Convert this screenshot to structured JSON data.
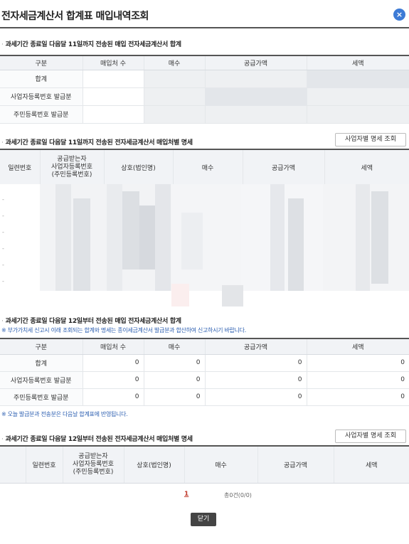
{
  "window": {
    "title": "전자세금계산서 합계표 매입내역조회",
    "close_icon": "close-icon"
  },
  "section1": {
    "title": "과세기간 종료일 다음달 11일까지 전송된 매입 전자세금계산서 합계",
    "headers": [
      "구분",
      "매입처 수",
      "매수",
      "공급가액",
      "세액"
    ],
    "rows": [
      {
        "label": "합계"
      },
      {
        "label": "사업자등록번호 발급분"
      },
      {
        "label": "주민등록번호 발급분"
      }
    ]
  },
  "section2": {
    "title": "과세기간 종료일 다음달 11일까지 전송된 전자세금계산서 매입처별 명세",
    "button_label": "사업자별 명세 조회",
    "headers": [
      "일련번호",
      "공급받는자\n사업자등록번호\n(주민등록번호)",
      "상호(법인명)",
      "매수",
      "공급가액",
      "세액"
    ],
    "row_markers": [
      "-",
      "-",
      "-",
      "-",
      "-",
      "-"
    ]
  },
  "section3": {
    "title": "과세기간 종료일 다음달 12일부터 전송된 매입 전자세금계산서 합계",
    "note": "※ 부가가치세 신고시 이래 조회되는 합계와 명세는 종이세금계산서 발급분과 합산하여 신고하시기 바랍니다.",
    "headers": [
      "구분",
      "매입처 수",
      "매수",
      "공급가액",
      "세액"
    ],
    "rows": [
      {
        "label": "합계",
        "values": [
          "0",
          "0",
          "0",
          "0"
        ]
      },
      {
        "label": "사업자등록번호 발급분",
        "values": [
          "0",
          "0",
          "0",
          "0"
        ]
      },
      {
        "label": "주민등록번호 발급분",
        "values": [
          "0",
          "0",
          "0",
          "0"
        ]
      }
    ],
    "footnote": "※ 오늘 발급분과 전송분은 다음날 합계표에 반영됩니다."
  },
  "section4": {
    "title": "과세기간 종료일 다음달 12일부터 전송된 전자세금계산서 매입처별 명세",
    "button_label": "사업자별 명세 조회",
    "headers": [
      "일련번호",
      "공급받는자\n사업자등록번호\n(주민등록번호)",
      "상호(법인명)",
      "매수",
      "공급가액",
      "세액"
    ]
  },
  "pagination": {
    "current_page": "1",
    "total_text": "총0건(0/0)"
  },
  "footer": {
    "close_label": "닫기"
  }
}
